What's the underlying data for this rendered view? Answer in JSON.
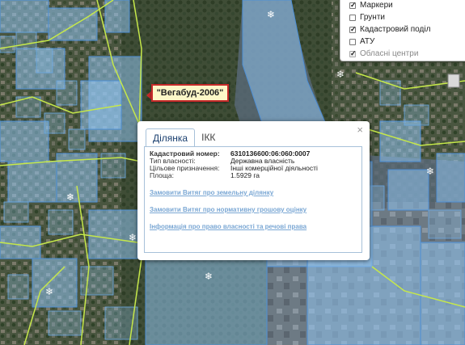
{
  "layers_panel": {
    "items": [
      {
        "label": "Маркери",
        "checked": true,
        "disabled": false
      },
      {
        "label": "Грунти",
        "checked": false,
        "disabled": false
      },
      {
        "label": "Кадастровий поділ",
        "checked": true,
        "disabled": false
      },
      {
        "label": "АТУ",
        "checked": false,
        "disabled": false
      },
      {
        "label": "Обласні центри",
        "checked": true,
        "disabled": true
      }
    ]
  },
  "marker_label": "\"Вегабуд-2006\"",
  "popup": {
    "tabs": [
      "Ділянка",
      "ІКК"
    ],
    "close_symbol": "×",
    "fields": [
      {
        "key": "Кадастровий номер:",
        "value": "6310136600:06:060:0007"
      },
      {
        "key": "Тип власності:",
        "value": "Державна власність"
      },
      {
        "key": "Цільове призначення:",
        "value": "Інші комерційної діяльності"
      },
      {
        "key": "Площа:",
        "value": "1.5929 га"
      }
    ],
    "links": [
      "Замовити Витяг про земельну ділянку",
      "Замовити Витяг про нормативну грошову оцінку",
      "Інформація про право власності та речові права"
    ]
  },
  "colors": {
    "parcel_fill": "#8fc3ef",
    "parcel_stroke": "#4d8fd6",
    "road_line": "#c6e84a",
    "marker_border": "#c62a2a"
  }
}
